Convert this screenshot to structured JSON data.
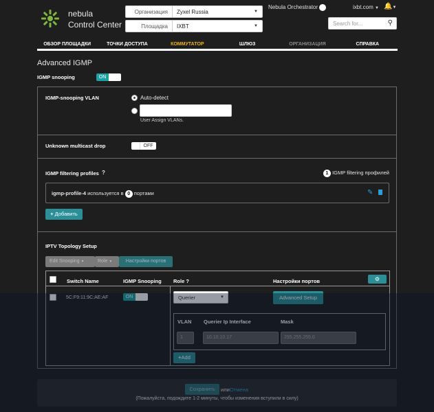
{
  "header": {
    "brand_line1": "nebula",
    "brand_line2": "Control Center",
    "org_label": "Организация",
    "org_value": "Zyxel Russia",
    "site_label": "Площадка",
    "site_value": "IXBT",
    "orchestrator": "Nebula Orchestrator",
    "account": "ixbt.com",
    "search_placeholder": "Search for..."
  },
  "nav": [
    "ОБЗОР ПЛОЩАДКИ",
    "ТОЧКИ ДОСТУПА",
    "КОММУТАТОР",
    "ШЛЮЗ",
    "ОРГАНИЗАЦИЯ",
    "СПРАВКА"
  ],
  "page": {
    "title": "Advanced IGMP",
    "igmp_snooping_label": "IGMP snooping",
    "igmp_snooping_state": "ON"
  },
  "vlan": {
    "label": "IGMP-snooping VLAN",
    "auto_detect": "Auto-detect",
    "user_assign": "User Assign VLANs."
  },
  "multicast": {
    "label": "Unknown multicast drop",
    "state": "OFF"
  },
  "filtering": {
    "label": "IGMP filtering profiles",
    "count": "1",
    "count_label": "IGMP filtering профилей",
    "profile_name": "igmp-profile-4",
    "profile_used_in": "используется в",
    "profile_ports": "0",
    "profile_ports_label": "портами",
    "add_button": "Добавить"
  },
  "iptv": {
    "title": "IPTV Topology Setup",
    "dd1": "Edit Snooping",
    "dd2": "Role",
    "port_settings_button": "Настройки портов",
    "columns": {
      "switch_name": "Switch Name",
      "igmp_snooping": "IGMP Snooping",
      "role": "Role",
      "port_settings": "Настройки портов"
    },
    "row": {
      "switch_name": "5C:F9:11:9C:AE:AF",
      "snooping": "ON",
      "role": "Querier",
      "advanced_button": "Advanced Setup"
    },
    "querier": {
      "col_vlan": "VLAN",
      "col_iface": "Querier Ip Interface",
      "col_mask": "Mask",
      "vlan": "1",
      "ip": "10.10.10.17",
      "mask": "255.255.255.0",
      "add_button": "Add"
    }
  },
  "footer": {
    "save": "Сохранить",
    "or": "или",
    "cancel": "Отмена",
    "note": "(Пожалуйста, подождите 1-2 минуты, чтобы изменения вступили в силу)"
  }
}
